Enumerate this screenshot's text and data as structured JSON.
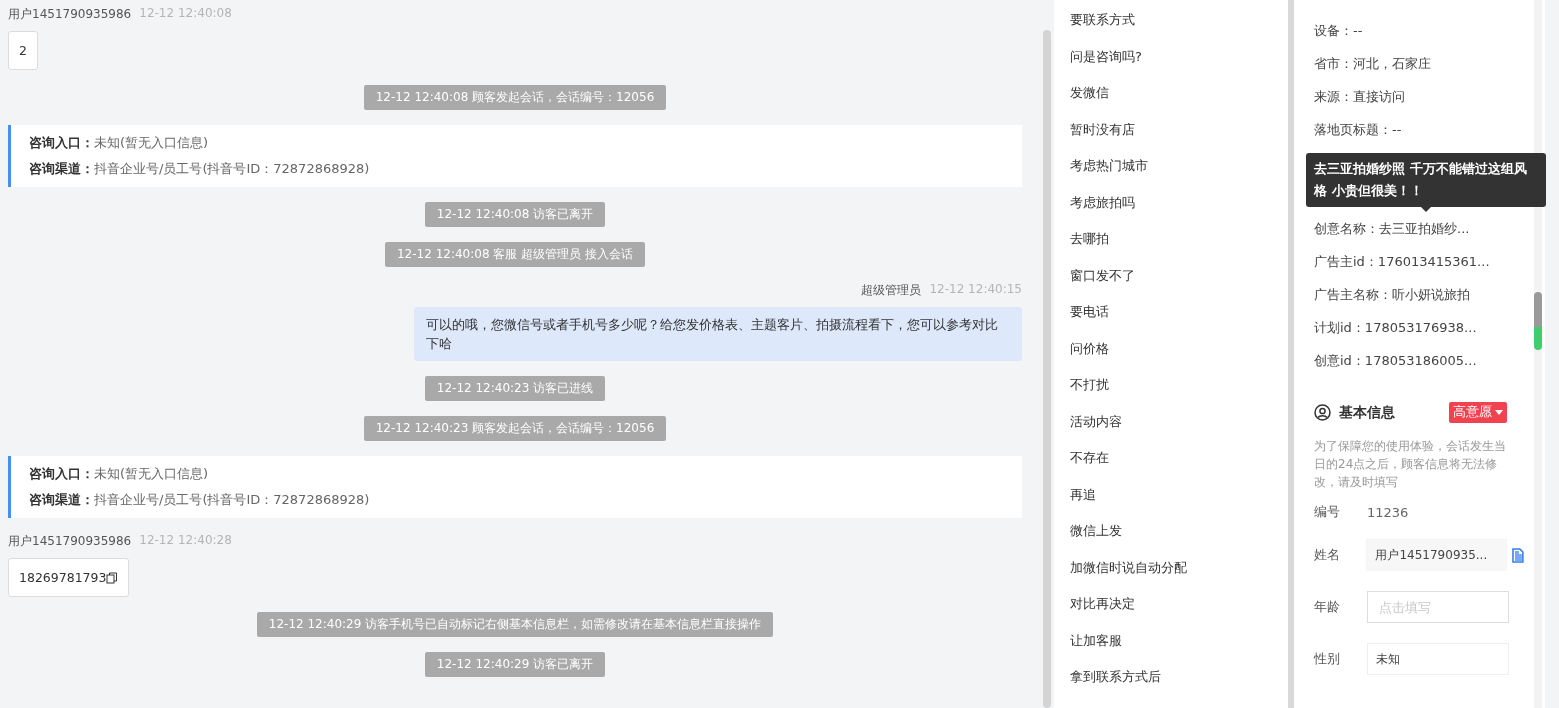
{
  "chat": {
    "messages": [
      {
        "kind": "user",
        "sender": "用户1451790935986",
        "time": "12-12 12:40:08",
        "text": "2"
      },
      {
        "kind": "system",
        "text": "12-12 12:40:08 顾客发起会话，会话编号：12056"
      },
      {
        "kind": "entry",
        "lines": [
          {
            "label": "咨询入口：",
            "value": "未知(暂无入口信息)"
          },
          {
            "label": "咨询渠道：",
            "value": "抖音企业号/员工号(抖音号ID：72872868928)"
          }
        ]
      },
      {
        "kind": "system",
        "text": "12-12 12:40:08 访客已离开"
      },
      {
        "kind": "system",
        "text": "12-12 12:40:08 客服 超级管理员 接入会话"
      },
      {
        "kind": "agent",
        "sender": "超级管理员",
        "time": "12-12 12:40:15",
        "text": "可以的哦，您微信号或者手机号多少呢？给您发价格表、主题客片、拍摄流程看下，您可以参考对比下哈"
      },
      {
        "kind": "system",
        "text": "12-12 12:40:23 访客已进线"
      },
      {
        "kind": "system",
        "text": "12-12 12:40:23 顾客发起会话，会话编号：12056"
      },
      {
        "kind": "entry",
        "lines": [
          {
            "label": "咨询入口：",
            "value": "未知(暂无入口信息)"
          },
          {
            "label": "咨询渠道：",
            "value": "抖音企业号/员工号(抖音号ID：72872868928)"
          }
        ]
      },
      {
        "kind": "phone",
        "sender": "用户1451790935986",
        "time": "12-12 12:40:28",
        "text": "18269781793"
      },
      {
        "kind": "system",
        "text": "12-12 12:40:29 访客手机号已自动标记右侧基本信息栏，如需修改请在基本信息栏直接操作"
      },
      {
        "kind": "system",
        "text": "12-12 12:40:29 访客已离开"
      }
    ]
  },
  "quick_replies": [
    "要联系方式",
    "问是咨询吗?",
    "发微信",
    "暂时没有店",
    "考虑热门城市",
    "考虑旅拍吗",
    "去哪拍",
    "窗口发不了",
    "要电话",
    "问价格",
    "不打扰",
    "活动内容",
    "不存在",
    "再追",
    "微信上发",
    "加微信时说自动分配",
    "对比再决定",
    "让加客服",
    "拿到联系方式后"
  ],
  "visitor_info": {
    "rows": [
      {
        "kind": "text",
        "text": "设备：--"
      },
      {
        "kind": "text",
        "text": "省市：河北，石家庄"
      },
      {
        "kind": "text",
        "text": "来源：直接访问"
      },
      {
        "kind": "text",
        "text": "落地页标题：--"
      },
      {
        "kind": "hidden"
      },
      {
        "kind": "hidden"
      },
      {
        "kind": "text",
        "text": "创意名称：去三亚拍婚纱..."
      },
      {
        "kind": "text",
        "text": "广告主id：176013415361..."
      },
      {
        "kind": "text",
        "text": "广告主名称：听小妍说旅拍"
      },
      {
        "kind": "text",
        "text": "计划id：178053176938..."
      },
      {
        "kind": "text",
        "text": "创意id：178053186005..."
      }
    ],
    "tooltip": "去三亚拍婚纱照 千万不能错过这组风格 小贵但很美！！"
  },
  "basic_info": {
    "title": "基本信息",
    "intent": "高意愿",
    "note": "为了保障您的使用体验，会话发生当日的24点之后，顾客信息将无法修改，请及时填写",
    "fields": [
      {
        "kind": "static",
        "label": "编号",
        "value": "11236"
      },
      {
        "kind": "copy",
        "label": "姓名",
        "value": "用户1451790935..."
      },
      {
        "kind": "input",
        "label": "年龄",
        "placeholder": "点击填写"
      },
      {
        "kind": "select",
        "label": "性别",
        "value": "未知"
      }
    ]
  }
}
